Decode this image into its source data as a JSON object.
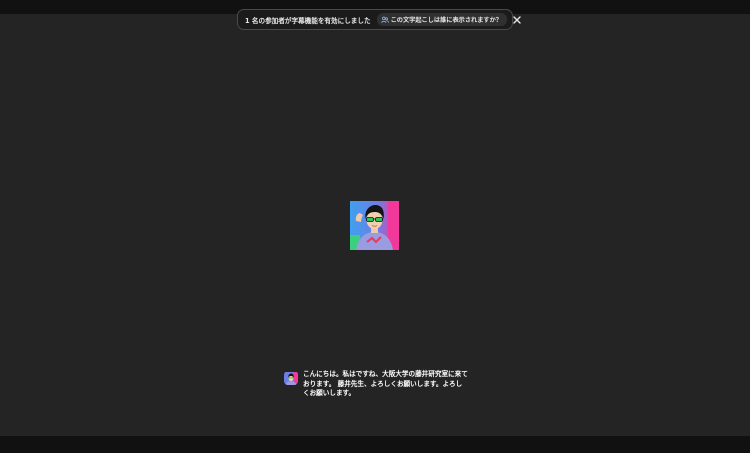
{
  "banner": {
    "message": "1 名の参加者が字幕機能を有効にしました",
    "chip_label": "この文字起こしは誰に表示されますか？",
    "chip_icon": "people-icon",
    "close_icon": "close-icon"
  },
  "participant": {
    "avatar_icon": "participant-avatar"
  },
  "caption": {
    "text": "こんにちは。私はですね、大阪大学の藤井研究室に来ております。 藤井先生、よろしくお願いします。よろしくお願いします。"
  },
  "colors": {
    "background": "#242424",
    "bar": "#111111",
    "banner": "#1b1b1b",
    "text": "#e8e8e8"
  }
}
